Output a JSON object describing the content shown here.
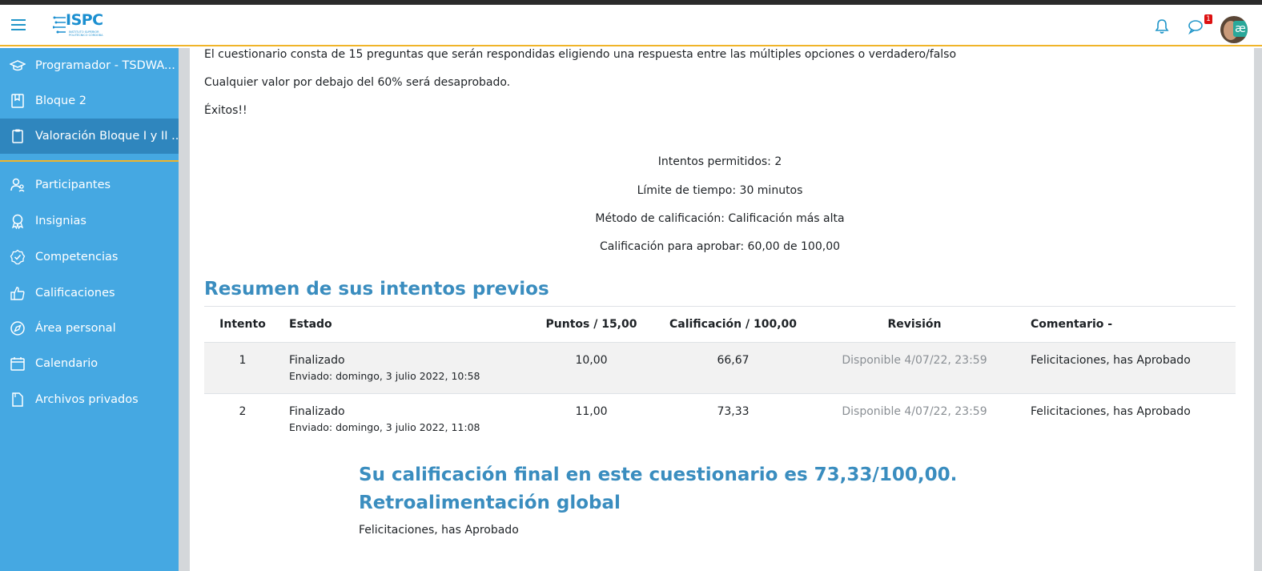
{
  "header": {
    "logo_text": "ISPC",
    "logo_subtitle_1": "INSTITUTO SUPERIOR",
    "logo_subtitle_2": "POLITÉCNICO CÓRDOBA",
    "notification_badge": "1",
    "avatar_chip": "æ"
  },
  "sidebar": {
    "items": [
      {
        "label": "Programador - TSDWA...",
        "icon": "graduation-cap-icon"
      },
      {
        "label": "Bloque 2",
        "icon": "book-icon"
      },
      {
        "label": "Valoración Bloque I y II ...",
        "icon": "clipboard-icon"
      },
      {
        "label": "Participantes",
        "icon": "users-icon"
      },
      {
        "label": "Insignias",
        "icon": "badge-icon"
      },
      {
        "label": "Competencias",
        "icon": "check-badge-icon"
      },
      {
        "label": "Calificaciones",
        "icon": "thumbs-up-icon"
      },
      {
        "label": "Área personal",
        "icon": "compass-icon"
      },
      {
        "label": "Calendario",
        "icon": "calendar-icon"
      },
      {
        "label": "Archivos privados",
        "icon": "file-icon"
      }
    ]
  },
  "intro": {
    "line1": "El cuestionario consta de 15 preguntas que serán respondidas eligiendo una respuesta entre las múltiples opciones o verdadero/falso",
    "line2": "Cualquier valor por debajo del 60%  será desaprobado.",
    "line3": "Éxitos!!"
  },
  "quiz_info": {
    "attempts": "Intentos permitidos: 2",
    "time_limit": "Límite de tiempo: 30 minutos",
    "grading_method": "Método de calificación: Calificación más alta",
    "pass_grade": "Calificación para aprobar: 60,00 de 100,00"
  },
  "summary": {
    "title": "Resumen de sus intentos previos",
    "columns": [
      "Intento",
      "Estado",
      "Puntos / 15,00",
      "Calificación / 100,00",
      "Revisión",
      "Comentario -"
    ],
    "rows": [
      {
        "attempt": "1",
        "state": "Finalizado",
        "submitted": "Enviado: domingo, 3 julio 2022, 10:58",
        "points": "10,00",
        "grade": "66,67",
        "review": "Disponible 4/07/22, 23:59",
        "comment": "Felicitaciones, has Aprobado"
      },
      {
        "attempt": "2",
        "state": "Finalizado",
        "submitted": "Enviado: domingo, 3 julio 2022, 11:08",
        "points": "11,00",
        "grade": "73,33",
        "review": "Disponible 4/07/22, 23:59",
        "comment": "Felicitaciones, has Aprobado"
      }
    ]
  },
  "final": {
    "grade_text": "Su calificación final en este cuestionario es 73,33/100,00.",
    "feedback_title": "Retroalimentación global",
    "feedback_text": "Felicitaciones, has Aprobado"
  },
  "colors": {
    "sidebar_bg": "#45a8e2",
    "sidebar_active": "#2f86be",
    "accent": "#f0b429",
    "heading": "#3a8dbf"
  }
}
